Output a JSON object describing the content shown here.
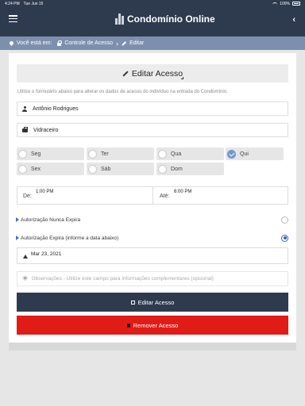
{
  "status_bar": {
    "time": "4:24 PM",
    "date": "Tue Jun 15",
    "battery": "100%"
  },
  "header": {
    "brand_name": "Condomínio Online"
  },
  "breadcrumb": {
    "prefix": "Você está em:",
    "items": [
      "Controle de Acesso",
      "Editar"
    ]
  },
  "form": {
    "title": "Editar Acesso",
    "helper_text": "Utilize o formulário abaixo para alterar os dados de acesso do indivíduo na entrada do Condomínio.",
    "name": "Antônio Rodrigues",
    "role": "Vidraceiro",
    "days": [
      {
        "label": "Seg",
        "checked": false
      },
      {
        "label": "Ter",
        "checked": false
      },
      {
        "label": "Qua",
        "checked": false
      },
      {
        "label": "Qui",
        "checked": true
      },
      {
        "label": "Sex",
        "checked": false
      },
      {
        "label": "Sáb",
        "checked": false
      },
      {
        "label": "Dom",
        "checked": false
      }
    ],
    "time_from_label": "De:",
    "time_from": "1:00 PM",
    "time_to_label": "Até:",
    "time_to": "6:00 PM",
    "option_never_expires": "Autorização Nunca Expira",
    "option_expires": "Autorização Expira (informe a data abaixo)",
    "selected_option": "expires",
    "expiry_date": "Mar 23, 2021",
    "observations_placeholder": "Observações - Utilize este campo para informações complementares (opcional)",
    "edit_button": "Editar Acesso",
    "remove_button": "Remover Acesso"
  },
  "colors": {
    "primary": "#2e3a4e",
    "breadcrumb": "#7e8fae",
    "danger": "#e11c17",
    "check": "#7795cf"
  }
}
